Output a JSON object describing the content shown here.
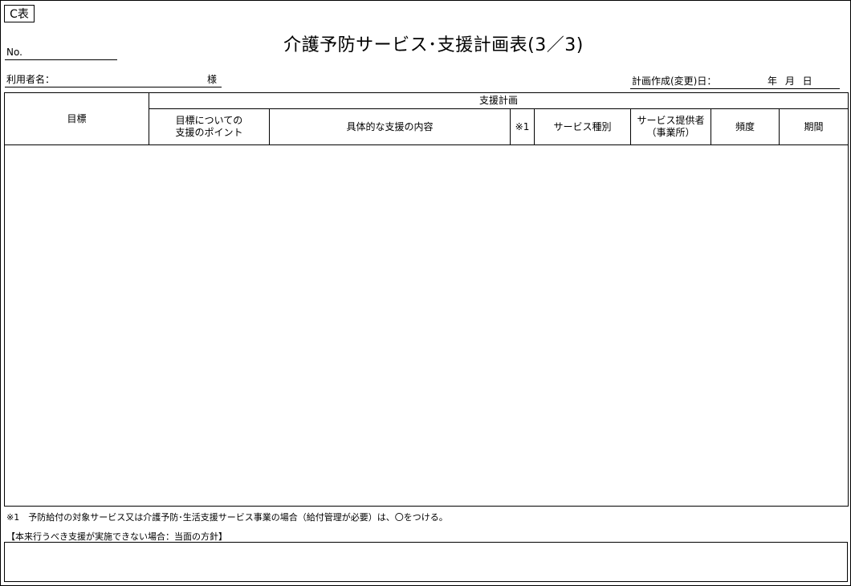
{
  "tag": "C表",
  "no_label": "No.",
  "title": "介護予防サービス･支援計画表(3／3)",
  "user": {
    "label": "利用者名：",
    "suffix": "様"
  },
  "date": {
    "label": "計画作成(変更)日：",
    "ymd": "年 月 日"
  },
  "table": {
    "goal_header": "目標",
    "plan_header": "支援計画",
    "columns": {
      "point_line1": "目標についての",
      "point_line2": "支援のポイント",
      "content": "具体的な支援の内容",
      "note1": "※1",
      "service_type": "サービス種別",
      "provider_line1": "サービス提供者",
      "provider_line2": "（事業所）",
      "frequency": "頻度",
      "period": "期間"
    }
  },
  "note": "※1　予防給付の対象サービス又は介護予防･生活支援サービス事業の場合（給付管理が必要）は、〇をつける。",
  "policy_label": "【本来行うべき支援が実施できない場合：当面の方針】"
}
